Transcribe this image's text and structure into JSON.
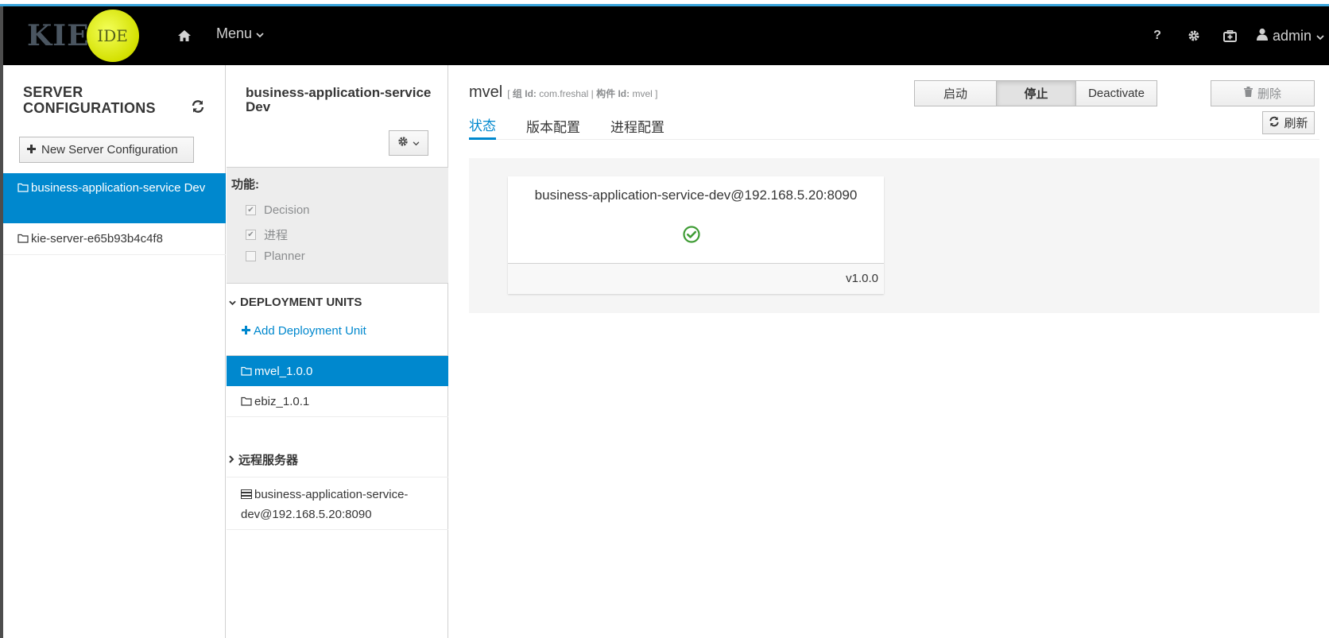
{
  "header": {
    "logo_text": "KIE",
    "logo_badge": "IDE",
    "menu_label": "Menu",
    "help_label": "?",
    "user_name": "admin"
  },
  "server_configs": {
    "title_line1": "SERVER",
    "title_line2": "CONFIGURATIONS",
    "new_button": "New Server Configuration",
    "items": [
      {
        "label": "business-application-service Dev",
        "active": true
      },
      {
        "label": "kie-server-e65b93b4c4f8",
        "active": false
      }
    ]
  },
  "config_detail": {
    "title": "business-application-service Dev",
    "features_label": "功能:",
    "features": [
      {
        "label": "Decision",
        "checked": true
      },
      {
        "label": "进程",
        "checked": true
      },
      {
        "label": "Planner",
        "checked": false
      }
    ],
    "deployment_units_header": "DEPLOYMENT UNITS",
    "add_unit": "Add Deployment Unit",
    "units": [
      {
        "label": "mvel_1.0.0",
        "active": true
      },
      {
        "label": "ebiz_1.0.1",
        "active": false
      }
    ],
    "remote_header": "远程服务器",
    "remote_servers": [
      "business-application-service-dev@192.168.5.20:8090"
    ]
  },
  "main": {
    "name": "mvel",
    "meta_open": "[",
    "group_label": "组 Id:",
    "group_value": "com.freshal",
    "separator": "|",
    "artifact_label": "构件 Id:",
    "artifact_value": "mvel",
    "meta_close": "]",
    "start_button": "启动",
    "stop_button": "停止",
    "deactivate_button": "Deactivate",
    "delete_button": "删除",
    "refresh_button": "刷新",
    "tabs": [
      {
        "label": "状态",
        "active": true
      },
      {
        "label": "版本配置",
        "active": false
      },
      {
        "label": "进程配置",
        "active": false
      }
    ],
    "card": {
      "title": "business-application-service-dev@192.168.5.20:8090",
      "status": "ok-icon",
      "version": "v1.0.0"
    }
  },
  "colors": {
    "accent": "#0088ce",
    "navbar": "#000000",
    "top_stripe": "#39a5dc",
    "ok": "#3f9c35"
  }
}
